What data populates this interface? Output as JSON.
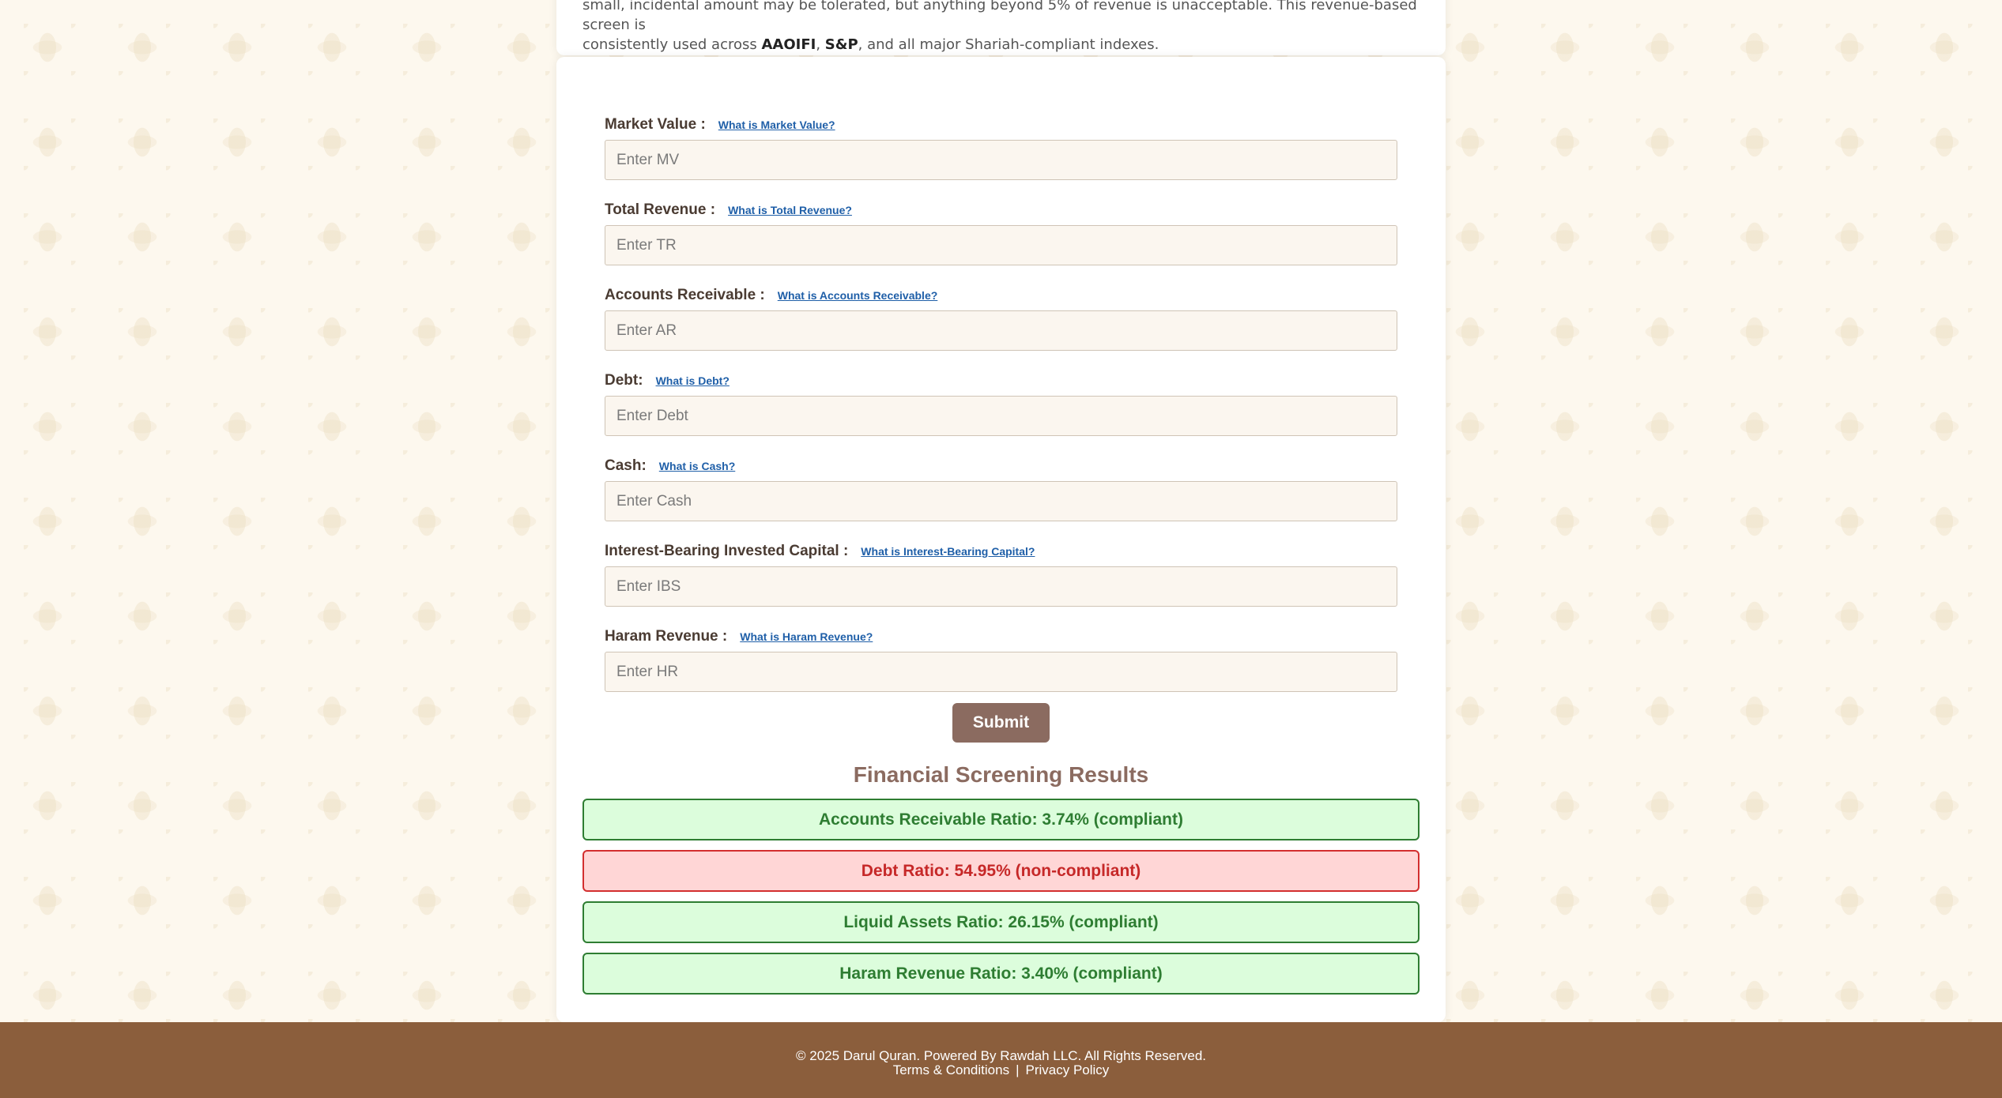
{
  "intro": {
    "line1": "small, incidental amount may be tolerated, but anything beyond 5% of revenue is unacceptable. This revenue-based screen is",
    "line2_prefix": "consistently used across ",
    "aaoifi": "AAOIFI",
    "comma": ", ",
    "sp": "S&P",
    "line2_suffix": ", and all major Shariah-compliant indexes."
  },
  "form": {
    "fields": [
      {
        "label": "Market Value :",
        "help": "What is Market Value?",
        "placeholder": "Enter MV"
      },
      {
        "label": "Total Revenue :",
        "help": "What is Total Revenue?",
        "placeholder": "Enter TR"
      },
      {
        "label": "Accounts Receivable :",
        "help": "What is Accounts Receivable?",
        "placeholder": "Enter AR"
      },
      {
        "label": "Debt:",
        "help": "What is Debt?",
        "placeholder": "Enter Debt"
      },
      {
        "label": "Cash:",
        "help": "What is Cash?",
        "placeholder": "Enter Cash"
      },
      {
        "label": "Interest-Bearing Invested Capital :",
        "help": "What is Interest-Bearing Capital?",
        "placeholder": "Enter IBS"
      },
      {
        "label": "Haram Revenue :",
        "help": "What is Haram Revenue?",
        "placeholder": "Enter HR"
      }
    ],
    "submit_label": "Submit"
  },
  "results": {
    "title": "Financial Screening Results",
    "items": [
      {
        "text": "Accounts Receivable Ratio: 3.74% (compliant)",
        "status": "compliant"
      },
      {
        "text": "Debt Ratio: 54.95% (non-compliant)",
        "status": "non-compliant"
      },
      {
        "text": "Liquid Assets Ratio: 26.15% (compliant)",
        "status": "compliant"
      },
      {
        "text": "Haram Revenue Ratio: 3.40% (compliant)",
        "status": "compliant"
      }
    ]
  },
  "footer": {
    "copyright": "© 2025 Darul Quran. Powered By Rawdah LLC. All Rights Reserved.",
    "terms": "Terms & Conditions",
    "separator": "|",
    "privacy": "Privacy Policy"
  },
  "colors": {
    "accent_brown": "#8b6b60",
    "footer_brown": "#8b5e3c",
    "compliant_green": "#2e7d32",
    "noncompliant_red": "#c62828",
    "link_blue": "#1f5fa8"
  }
}
